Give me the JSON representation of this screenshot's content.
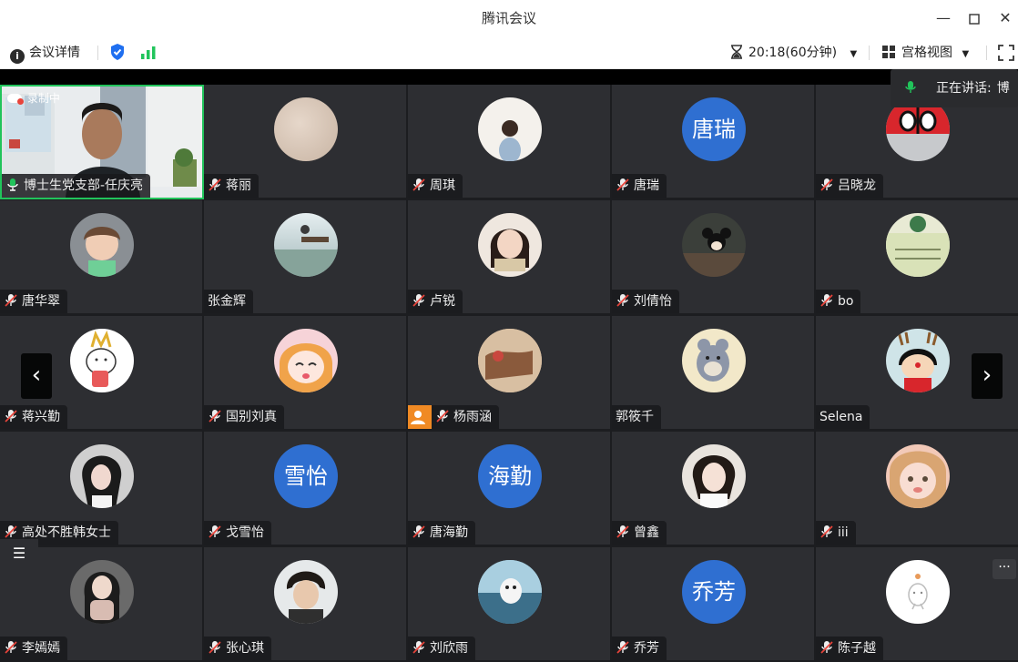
{
  "window": {
    "title": "腾讯会议"
  },
  "toolbar": {
    "meeting_details": "会议详情",
    "timer": "20:18(60分钟)",
    "view_mode": "宫格视图"
  },
  "recording": {
    "label": "录制中"
  },
  "speaking": {
    "label": "正在讲话:",
    "name": "博"
  },
  "colors": {
    "accent": "#2f6fd1",
    "active_border": "#21c45b",
    "signal": "#21c45b",
    "shield": "#1f6ff0"
  },
  "participants": [
    {
      "name": "博士生党支部-任庆亮",
      "muted": false,
      "video": true
    },
    {
      "name": "蒋丽",
      "muted": true
    },
    {
      "name": "周琪",
      "muted": true
    },
    {
      "name": "唐瑞",
      "muted": true,
      "avatar_text": "唐瑞"
    },
    {
      "name": "吕晓龙",
      "muted": true
    },
    {
      "name": "唐华翠",
      "muted": true
    },
    {
      "name": "张金辉",
      "muted": false,
      "no_mic": true
    },
    {
      "name": "卢锐",
      "muted": true
    },
    {
      "name": "刘倩怡",
      "muted": true
    },
    {
      "name": "bo",
      "muted": true
    },
    {
      "name": "蒋兴勤",
      "muted": true
    },
    {
      "name": "国别刘真",
      "muted": true
    },
    {
      "name": "杨雨涵",
      "muted": true,
      "sharing": true
    },
    {
      "name": "郭筱千",
      "muted": false,
      "no_mic": true
    },
    {
      "name": "Selena",
      "muted": false,
      "no_mic": true
    },
    {
      "name": "高处不胜韩女士",
      "muted": true
    },
    {
      "name": "戈雪怡",
      "muted": true,
      "avatar_text": "雪怡"
    },
    {
      "name": "唐海勤",
      "muted": true,
      "avatar_text": "海勤"
    },
    {
      "name": "曾鑫",
      "muted": true
    },
    {
      "name": "iii",
      "muted": true
    },
    {
      "name": "李嫣嫣",
      "muted": true
    },
    {
      "name": "张心琪",
      "muted": true
    },
    {
      "name": "刘欣雨",
      "muted": true
    },
    {
      "name": "乔芳",
      "muted": true,
      "avatar_text": "乔芳"
    },
    {
      "name": "陈子越",
      "muted": true
    }
  ]
}
